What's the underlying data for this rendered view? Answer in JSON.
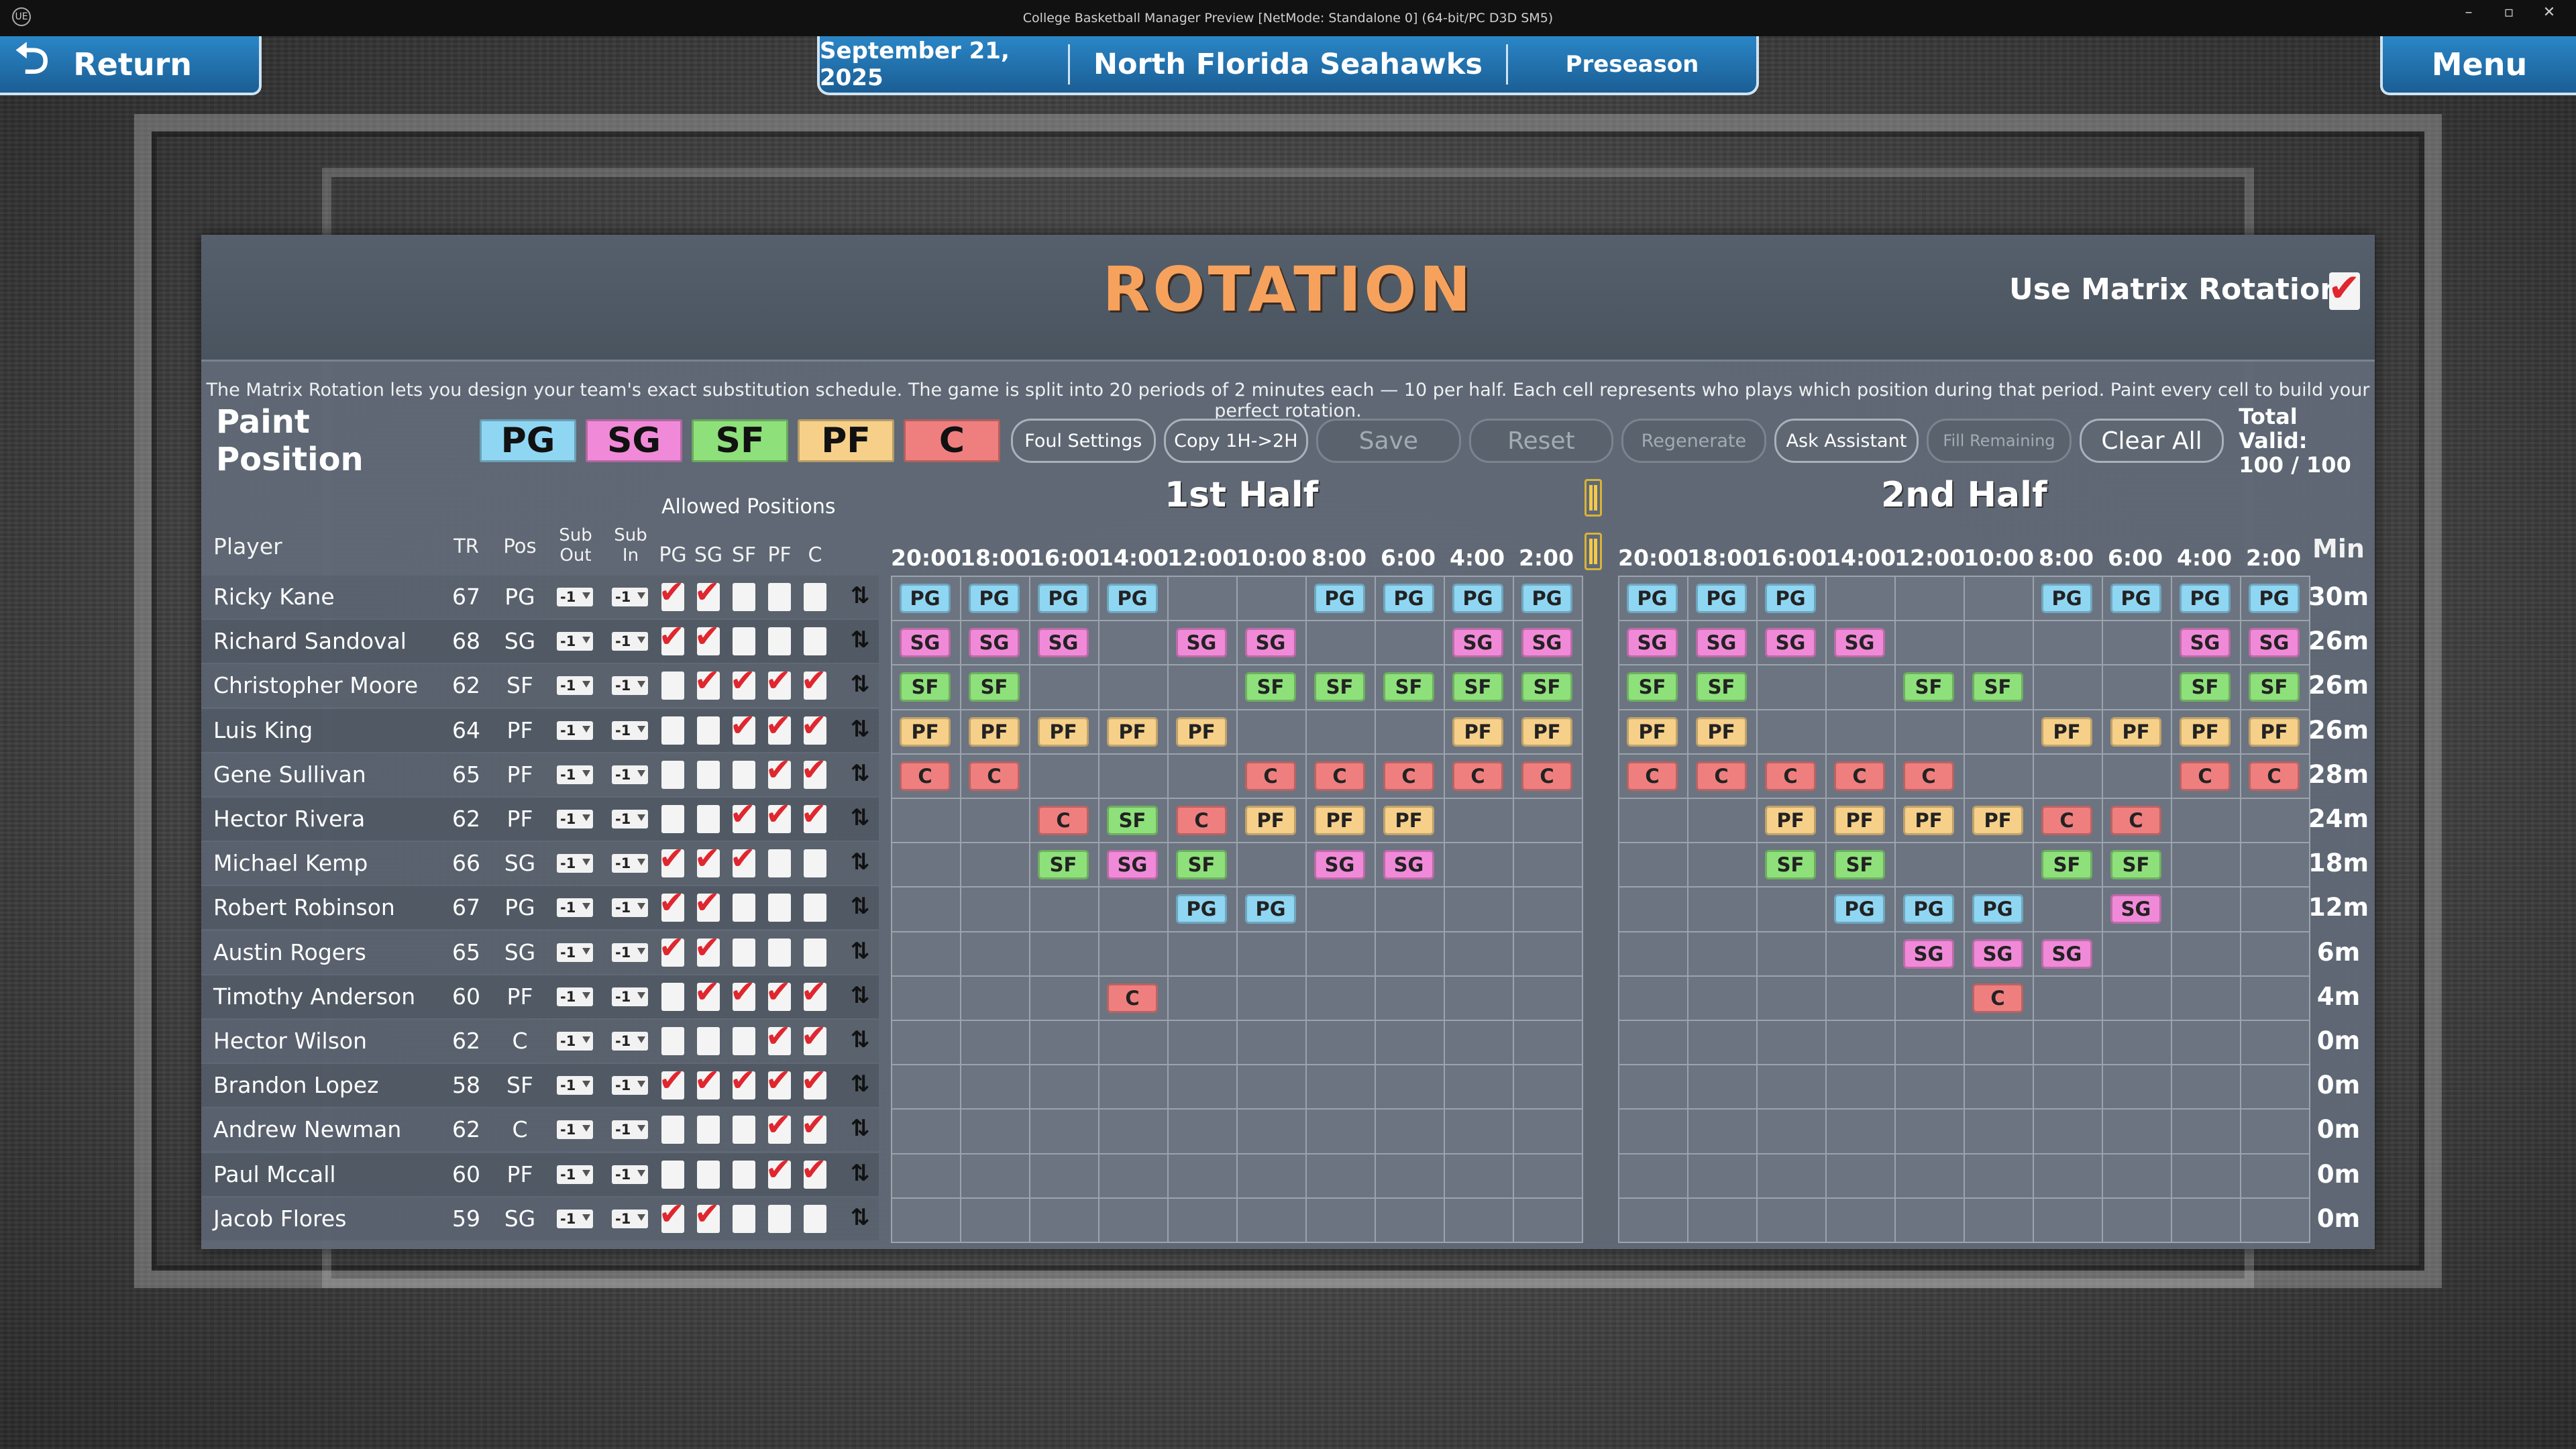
{
  "window": {
    "title": "College Basketball Manager Preview [NetMode: Standalone 0]  (64-bit/PC D3D SM5)",
    "logo": "UE"
  },
  "nav": {
    "return_label": "Return",
    "menu_label": "Menu",
    "date": "September 21, 2025",
    "team": "North Florida Seahawks",
    "phase": "Preseason"
  },
  "page": {
    "title": "ROTATION",
    "matrix_question": "Use Matrix Rotation?",
    "matrix_enabled": true,
    "description": "The Matrix Rotation lets you design your team's exact substitution schedule. The game is split into 20 periods of 2 minutes each — 10 per half. Each cell represents who plays which position during that period. Paint every cell to build your perfect rotation."
  },
  "paint": {
    "label": "Paint Position",
    "positions": [
      {
        "code": "PG",
        "color": "#8fd6f3"
      },
      {
        "code": "SG",
        "color": "#f08ad8"
      },
      {
        "code": "SF",
        "color": "#8ee07b"
      },
      {
        "code": "PF",
        "color": "#f6d089"
      },
      {
        "code": "C",
        "color": "#ef7f7f"
      }
    ]
  },
  "actions": {
    "foul_settings": "Foul Settings",
    "copy": "Copy 1H->2H",
    "save": "Save",
    "reset": "Reset",
    "regenerate": "Regenerate",
    "ask_assistant": "Ask Assistant",
    "fill_remaining": "Fill Remaining",
    "clear_all": "Clear All",
    "total_label": "Total Valid:",
    "total_value": "100 / 100"
  },
  "table": {
    "first_half": "1st Half",
    "second_half": "2nd Half",
    "allowed_label": "Allowed Positions",
    "cols": {
      "player": "Player",
      "tr": "TR",
      "pos": "Pos",
      "sub_out_1": "Sub",
      "sub_out_2": "Out",
      "sub_in_1": "Sub",
      "sub_in_2": "In",
      "min": "Min"
    },
    "allowed_cols": [
      "PG",
      "SG",
      "SF",
      "PF",
      "C"
    ],
    "times": [
      "20:00",
      "18:00",
      "16:00",
      "14:00",
      "12:00",
      "10:00",
      "8:00",
      "6:00",
      "4:00",
      "2:00"
    ]
  },
  "players": [
    {
      "name": "Ricky Kane",
      "tr": "67",
      "pos": "PG",
      "sub_out": "-1",
      "sub_in": "-1",
      "allowed": [
        1,
        1,
        0,
        0,
        0
      ],
      "min": "30m",
      "h1": [
        "PG",
        "PG",
        "PG",
        "PG",
        "",
        "",
        "PG",
        "PG",
        "PG",
        "PG"
      ],
      "h2": [
        "PG",
        "PG",
        "PG",
        "",
        "",
        "",
        "PG",
        "PG",
        "PG",
        "PG"
      ]
    },
    {
      "name": "Richard Sandoval",
      "tr": "68",
      "pos": "SG",
      "sub_out": "-1",
      "sub_in": "-1",
      "allowed": [
        1,
        1,
        0,
        0,
        0
      ],
      "min": "26m",
      "h1": [
        "SG",
        "SG",
        "SG",
        "",
        "SG",
        "SG",
        "",
        "",
        "SG",
        "SG"
      ],
      "h2": [
        "SG",
        "SG",
        "SG",
        "SG",
        "",
        "",
        "",
        "",
        "SG",
        "SG"
      ]
    },
    {
      "name": "Christopher Moore",
      "tr": "62",
      "pos": "SF",
      "sub_out": "-1",
      "sub_in": "-1",
      "allowed": [
        0,
        1,
        1,
        1,
        1
      ],
      "min": "26m",
      "h1": [
        "SF",
        "SF",
        "",
        "",
        "",
        "SF",
        "SF",
        "SF",
        "SF",
        "SF"
      ],
      "h2": [
        "SF",
        "SF",
        "",
        "",
        "SF",
        "SF",
        "",
        "",
        "SF",
        "SF"
      ]
    },
    {
      "name": "Luis King",
      "tr": "64",
      "pos": "PF",
      "sub_out": "-1",
      "sub_in": "-1",
      "allowed": [
        0,
        0,
        1,
        1,
        1
      ],
      "min": "26m",
      "h1": [
        "PF",
        "PF",
        "PF",
        "PF",
        "PF",
        "",
        "",
        "",
        "PF",
        "PF"
      ],
      "h2": [
        "PF",
        "PF",
        "",
        "",
        "",
        "",
        "PF",
        "PF",
        "PF",
        "PF"
      ]
    },
    {
      "name": "Gene Sullivan",
      "tr": "65",
      "pos": "PF",
      "sub_out": "-1",
      "sub_in": "-1",
      "allowed": [
        0,
        0,
        0,
        1,
        1
      ],
      "min": "28m",
      "h1": [
        "C",
        "C",
        "",
        "",
        "",
        "C",
        "C",
        "C",
        "C",
        "C"
      ],
      "h2": [
        "C",
        "C",
        "C",
        "C",
        "C",
        "",
        "",
        "",
        "C",
        "C"
      ]
    },
    {
      "name": "Hector Rivera",
      "tr": "62",
      "pos": "PF",
      "sub_out": "-1",
      "sub_in": "-1",
      "allowed": [
        0,
        0,
        1,
        1,
        1
      ],
      "min": "24m",
      "h1": [
        "",
        "",
        "C",
        "SF",
        "C",
        "PF",
        "PF",
        "PF",
        "",
        ""
      ],
      "h2": [
        "",
        "",
        "PF",
        "PF",
        "PF",
        "PF",
        "C",
        "C",
        "",
        ""
      ]
    },
    {
      "name": "Michael Kemp",
      "tr": "66",
      "pos": "SG",
      "sub_out": "-1",
      "sub_in": "-1",
      "allowed": [
        1,
        1,
        1,
        0,
        0
      ],
      "min": "18m",
      "h1": [
        "",
        "",
        "SF",
        "SG",
        "SF",
        "",
        "SG",
        "SG",
        "",
        ""
      ],
      "h2": [
        "",
        "",
        "SF",
        "SF",
        "",
        "",
        "SF",
        "SF",
        "",
        ""
      ]
    },
    {
      "name": "Robert Robinson",
      "tr": "67",
      "pos": "PG",
      "sub_out": "-1",
      "sub_in": "-1",
      "allowed": [
        1,
        1,
        0,
        0,
        0
      ],
      "min": "12m",
      "h1": [
        "",
        "",
        "",
        "",
        "PG",
        "PG",
        "",
        "",
        "",
        ""
      ],
      "h2": [
        "",
        "",
        "",
        "PG",
        "PG",
        "PG",
        "",
        "SG",
        "",
        ""
      ]
    },
    {
      "name": "Austin Rogers",
      "tr": "65",
      "pos": "SG",
      "sub_out": "-1",
      "sub_in": "-1",
      "allowed": [
        1,
        1,
        0,
        0,
        0
      ],
      "min": "6m",
      "h1": [
        "",
        "",
        "",
        "",
        "",
        "",
        "",
        "",
        "",
        ""
      ],
      "h2": [
        "",
        "",
        "",
        "",
        "SG",
        "SG",
        "SG",
        "",
        "",
        ""
      ]
    },
    {
      "name": "Timothy Anderson",
      "tr": "60",
      "pos": "PF",
      "sub_out": "-1",
      "sub_in": "-1",
      "allowed": [
        0,
        1,
        1,
        1,
        1
      ],
      "min": "4m",
      "h1": [
        "",
        "",
        "",
        "C",
        "",
        "",
        "",
        "",
        "",
        ""
      ],
      "h2": [
        "",
        "",
        "",
        "",
        "",
        "C",
        "",
        "",
        "",
        ""
      ]
    },
    {
      "name": "Hector Wilson",
      "tr": "62",
      "pos": "C",
      "sub_out": "-1",
      "sub_in": "-1",
      "allowed": [
        0,
        0,
        0,
        1,
        1
      ],
      "min": "0m",
      "h1": [
        "",
        "",
        "",
        "",
        "",
        "",
        "",
        "",
        "",
        ""
      ],
      "h2": [
        "",
        "",
        "",
        "",
        "",
        "",
        "",
        "",
        "",
        ""
      ]
    },
    {
      "name": "Brandon Lopez",
      "tr": "58",
      "pos": "SF",
      "sub_out": "-1",
      "sub_in": "-1",
      "allowed": [
        1,
        1,
        1,
        1,
        1
      ],
      "min": "0m",
      "h1": [
        "",
        "",
        "",
        "",
        "",
        "",
        "",
        "",
        "",
        ""
      ],
      "h2": [
        "",
        "",
        "",
        "",
        "",
        "",
        "",
        "",
        "",
        ""
      ]
    },
    {
      "name": "Andrew Newman",
      "tr": "62",
      "pos": "C",
      "sub_out": "-1",
      "sub_in": "-1",
      "allowed": [
        0,
        0,
        0,
        1,
        1
      ],
      "min": "0m",
      "h1": [
        "",
        "",
        "",
        "",
        "",
        "",
        "",
        "",
        "",
        ""
      ],
      "h2": [
        "",
        "",
        "",
        "",
        "",
        "",
        "",
        "",
        "",
        ""
      ]
    },
    {
      "name": "Paul Mccall",
      "tr": "60",
      "pos": "PF",
      "sub_out": "-1",
      "sub_in": "-1",
      "allowed": [
        0,
        0,
        0,
        1,
        1
      ],
      "min": "0m",
      "h1": [
        "",
        "",
        "",
        "",
        "",
        "",
        "",
        "",
        "",
        ""
      ],
      "h2": [
        "",
        "",
        "",
        "",
        "",
        "",
        "",
        "",
        "",
        ""
      ]
    },
    {
      "name": "Jacob Flores",
      "tr": "59",
      "pos": "SG",
      "sub_out": "-1",
      "sub_in": "-1",
      "allowed": [
        1,
        1,
        0,
        0,
        0
      ],
      "min": "0m",
      "h1": [
        "",
        "",
        "",
        "",
        "",
        "",
        "",
        "",
        "",
        ""
      ],
      "h2": [
        "",
        "",
        "",
        "",
        "",
        "",
        "",
        "",
        "",
        ""
      ]
    }
  ]
}
